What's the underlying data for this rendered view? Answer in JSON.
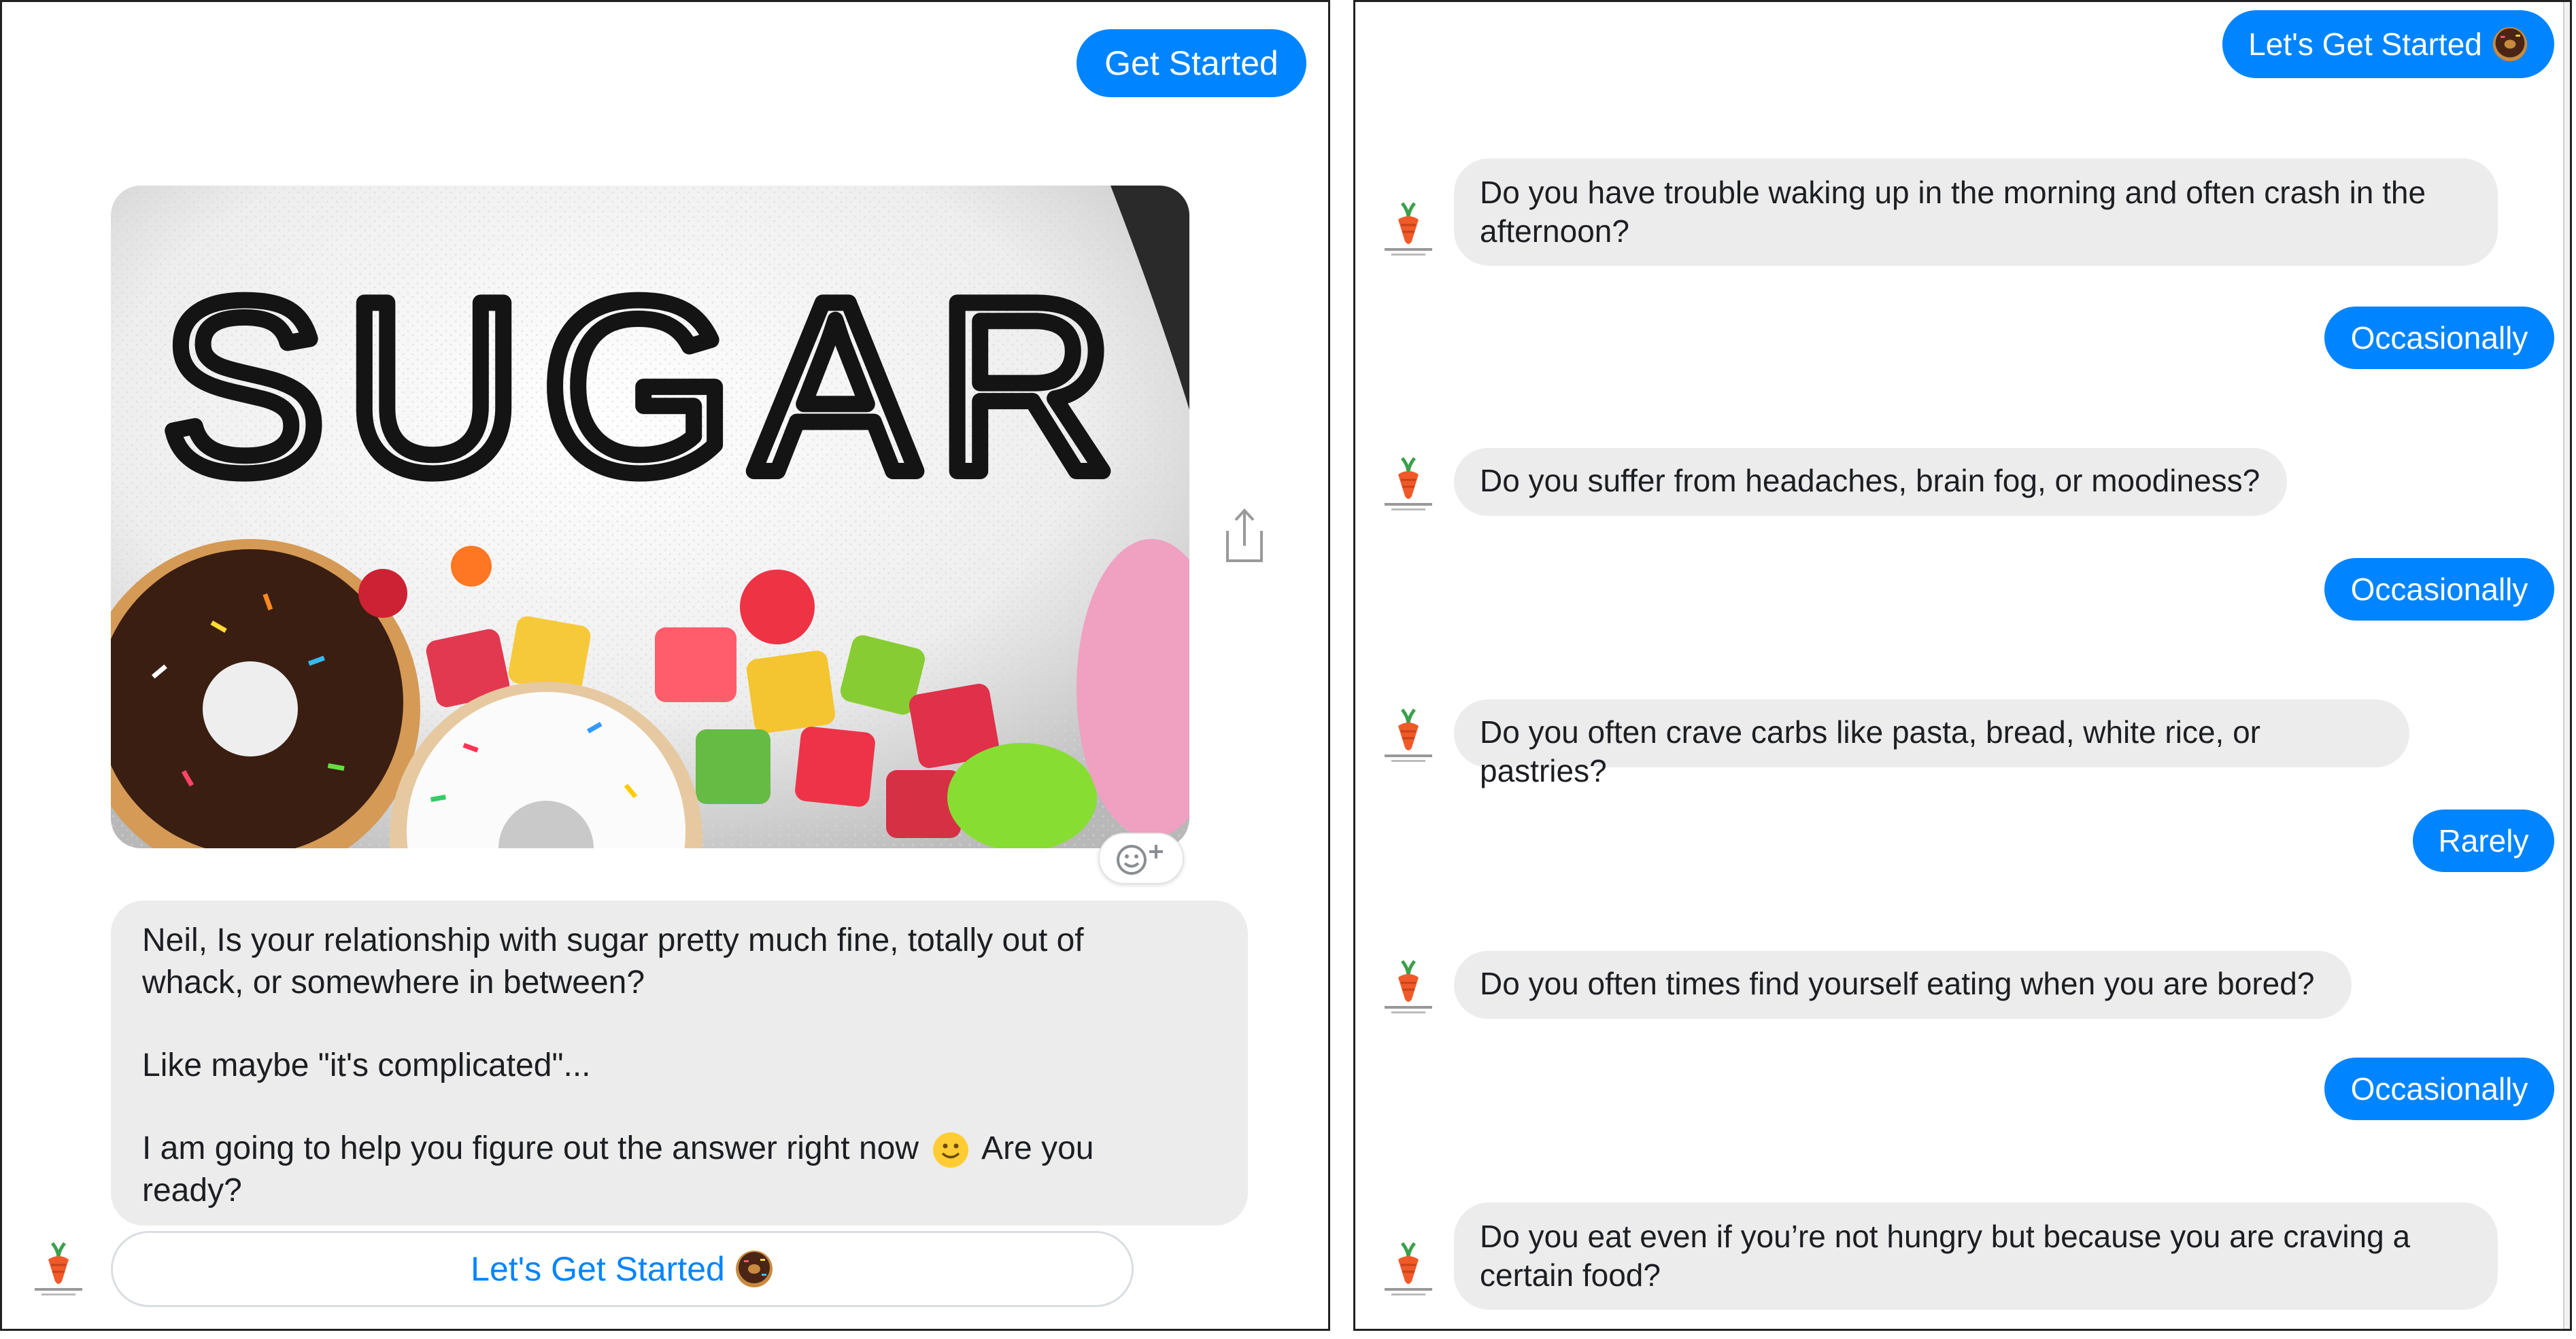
{
  "left_panel": {
    "get_started_label": "Get Started",
    "image_text": "SUGAR",
    "intro_message": {
      "line1": "Neil, Is your relationship with sugar pretty much fine, totally out of",
      "line2": "whack, or somewhere in between?",
      "line3": "Like maybe \"it's complicated\"...",
      "line4a": "I am going to help you figure out the answer right now",
      "line4b": "Are you",
      "line5": "ready?"
    },
    "cta_label": "Let's Get Started"
  },
  "right_panel": {
    "user_first_reply": "Let's Get Started",
    "questions": [
      {
        "line1": "Do you have trouble waking up in the morning and often crash in the",
        "line2": "afternoon?"
      },
      {
        "line1": "Do you suffer from headaches, brain fog, or moodiness?",
        "line2": ""
      },
      {
        "line1": "Do you often crave carbs like pasta, bread, white rice, or pastries?",
        "line2": ""
      },
      {
        "line1": "Do you often times find yourself eating when you are bored?",
        "line2": ""
      },
      {
        "line1": "Do you eat even if you’re not hungry but because you are craving a",
        "line2": "certain food?"
      }
    ],
    "answers": [
      "Occasionally",
      "Occasionally",
      "Rarely",
      "Occasionally"
    ]
  },
  "icons": {
    "bot_avatar": "carrot-logo-icon",
    "share": "share-icon",
    "reaction": "add-reaction-icon",
    "donut": "donut-emoji-icon",
    "smile": "smile-emoji-icon"
  },
  "colors": {
    "user_bubble": "#0084ff",
    "bot_bubble": "#ececec",
    "link_text": "#0084ff"
  }
}
